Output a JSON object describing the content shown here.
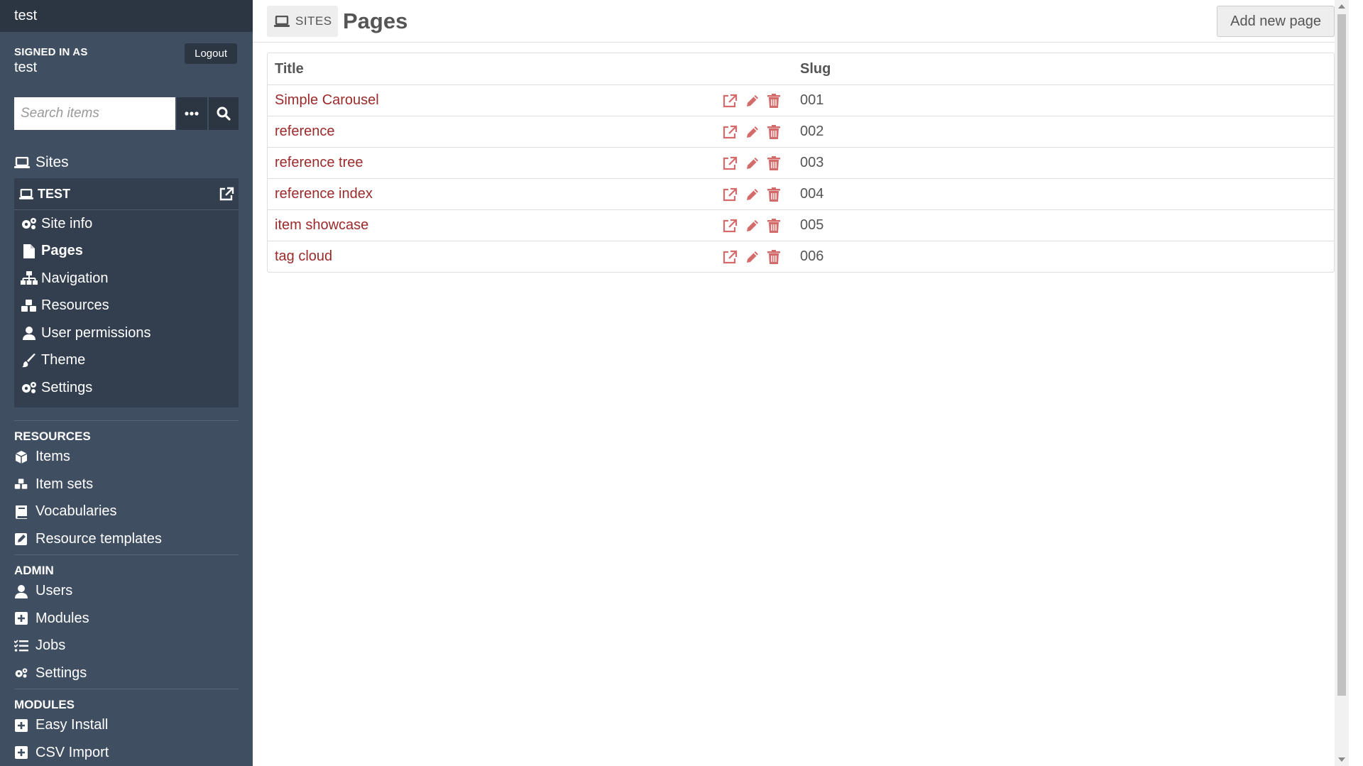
{
  "sidebar": {
    "brand": "test",
    "signed_in_label": "SIGNED IN AS",
    "username": "test",
    "logout_label": "Logout",
    "search_placeholder": "Search items",
    "sites_label": "Sites",
    "site": {
      "name": "TEST",
      "items": [
        {
          "label": "Site info",
          "icon": "gears-icon"
        },
        {
          "label": "Pages",
          "icon": "file-icon",
          "active": true
        },
        {
          "label": "Navigation",
          "icon": "sitemap-icon"
        },
        {
          "label": "Resources",
          "icon": "cubes-icon"
        },
        {
          "label": "User permissions",
          "icon": "user-icon"
        },
        {
          "label": "Theme",
          "icon": "brush-icon"
        },
        {
          "label": "Settings",
          "icon": "gears-icon"
        }
      ]
    },
    "resources_heading": "RESOURCES",
    "resources": [
      {
        "label": "Items",
        "icon": "cube-icon"
      },
      {
        "label": "Item sets",
        "icon": "cubes-icon"
      },
      {
        "label": "Vocabularies",
        "icon": "book-icon"
      },
      {
        "label": "Resource templates",
        "icon": "edit-icon"
      }
    ],
    "admin_heading": "ADMIN",
    "admin": [
      {
        "label": "Users",
        "icon": "user-icon"
      },
      {
        "label": "Modules",
        "icon": "plus-square-icon"
      },
      {
        "label": "Jobs",
        "icon": "tasks-icon"
      },
      {
        "label": "Settings",
        "icon": "gears-icon"
      }
    ],
    "modules_heading": "MODULES",
    "modules": [
      {
        "label": "Easy Install",
        "icon": "plus-square-icon"
      },
      {
        "label": "CSV Import",
        "icon": "plus-square-icon"
      }
    ]
  },
  "header": {
    "breadcrumb": "SITES",
    "title": "Pages",
    "add_button": "Add new page"
  },
  "table": {
    "columns": [
      "Title",
      "Slug"
    ],
    "rows": [
      {
        "title": "Simple Carousel",
        "slug": "001"
      },
      {
        "title": "reference",
        "slug": "002"
      },
      {
        "title": "reference tree",
        "slug": "003"
      },
      {
        "title": "reference index",
        "slug": "004"
      },
      {
        "title": "item showcase",
        "slug": "005"
      },
      {
        "title": "tag cloud",
        "slug": "006"
      }
    ]
  },
  "colors": {
    "sidebar_bg": "#404e61",
    "sidebar_dark": "#2c3542",
    "link": "#9b2a2a",
    "action_icon": "#d46b6b"
  }
}
